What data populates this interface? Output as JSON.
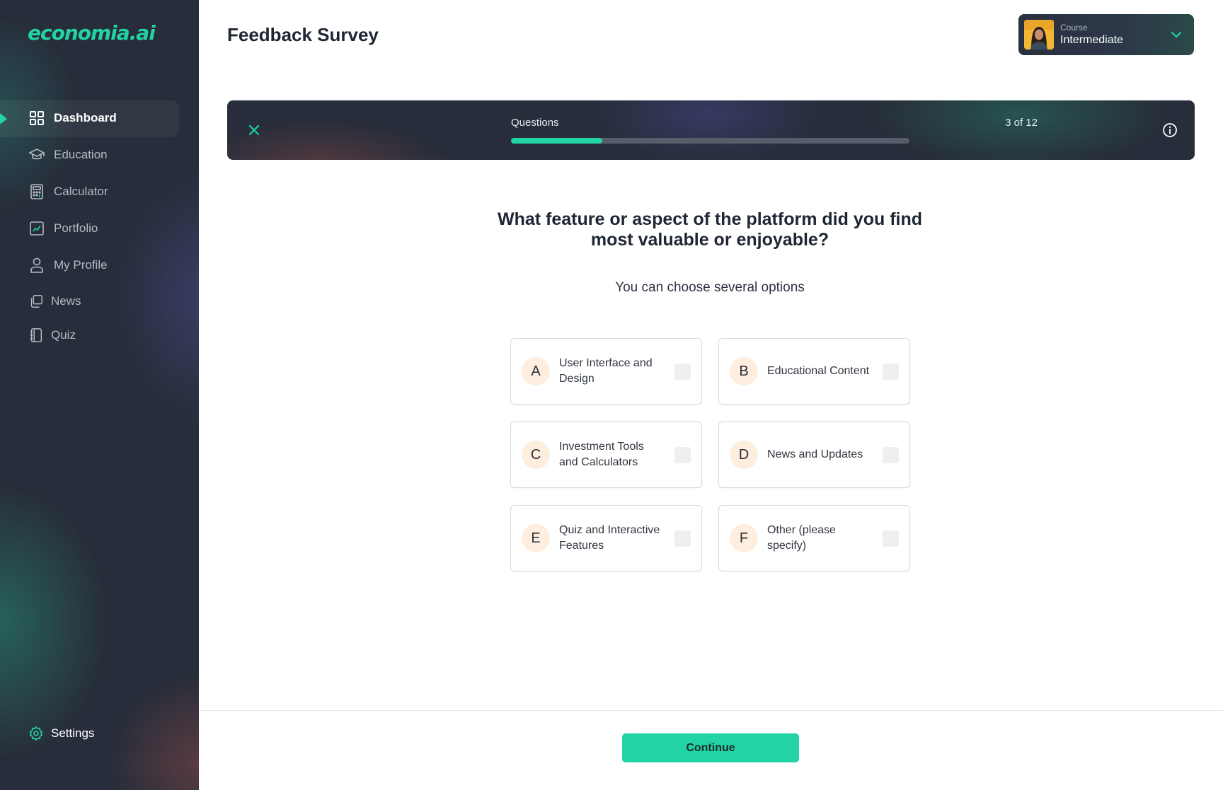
{
  "app": {
    "logo_text": "economia.ai",
    "accent_color": "#22d3a6"
  },
  "sidebar": {
    "items": [
      {
        "label": "Dashboard",
        "icon": "dashboard-grid-icon",
        "active": true
      },
      {
        "label": "Education",
        "icon": "graduation-cap-icon",
        "active": false
      },
      {
        "label": "Calculator",
        "icon": "calculator-icon",
        "active": false
      },
      {
        "label": "Portfolio",
        "icon": "chart-line-icon",
        "active": false
      },
      {
        "label": "My Profile",
        "icon": "user-icon",
        "active": false
      },
      {
        "label": "News",
        "icon": "copy-pages-icon",
        "active": false
      },
      {
        "label": "Quiz",
        "icon": "notebook-icon",
        "active": false
      }
    ],
    "settings_label": "Settings"
  },
  "header": {
    "title": "Feedback Survey",
    "course": {
      "caption": "Course",
      "value": "Intermediate"
    }
  },
  "progress": {
    "label": "Questions",
    "count_text": "3 of 12",
    "current": 3,
    "total": 12,
    "fraction": 0.23
  },
  "survey": {
    "question": "What feature or aspect of the platform did you find most valuable or enjoyable?",
    "hint": "You can choose several options",
    "options": [
      {
        "letter": "A",
        "text": "User Interface and Design",
        "checked": false
      },
      {
        "letter": "B",
        "text": "Educational Content",
        "checked": false
      },
      {
        "letter": "C",
        "text": "Investment Tools and Calculators",
        "checked": false
      },
      {
        "letter": "D",
        "text": "News and Updates",
        "checked": false
      },
      {
        "letter": "E",
        "text": "Quiz and Interactive Features",
        "checked": false
      },
      {
        "letter": "F",
        "text": "Other (please specify)",
        "checked": false
      }
    ]
  },
  "footer": {
    "continue_label": "Continue"
  }
}
